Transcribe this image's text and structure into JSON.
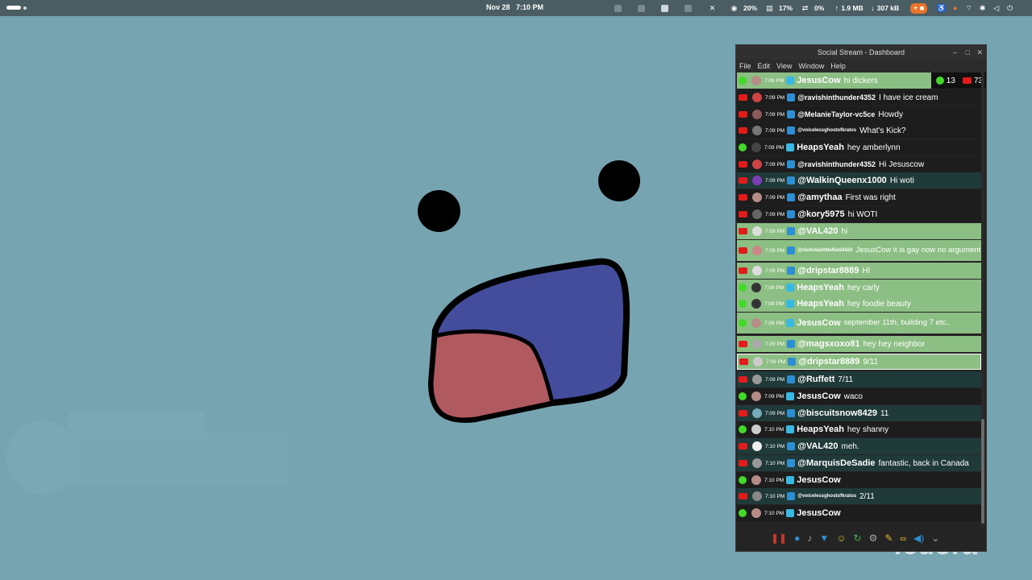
{
  "topbar": {
    "date": "Nov 28",
    "time": "7:10 PM",
    "cpu": "20%",
    "mem": "17%",
    "swap": "0%",
    "net_up": "1.9 MB",
    "net_down": "307 kB"
  },
  "window": {
    "title": "Social Stream - Dashboard",
    "menu": [
      "File",
      "Edit",
      "View",
      "Window",
      "Help"
    ],
    "counters": {
      "kick": "13",
      "youtube": "73"
    }
  },
  "messages": [
    {
      "platform": "kick",
      "time": "7:09 PM",
      "user": "JesusCow",
      "text": "hi dickers",
      "style": "green"
    },
    {
      "platform": "yt",
      "time": "7:09 PM",
      "user": "@ravishinthunder4352",
      "text": "I have ice cream",
      "style": "dark"
    },
    {
      "platform": "yt",
      "time": "7:09 PM",
      "user": "@MelanieTaylor-vc5ce",
      "text": "Howdy",
      "style": "dark"
    },
    {
      "platform": "yt",
      "time": "7:09 PM",
      "user": "@voicelessghostofkratos",
      "text": "What's Kick?",
      "style": "dark"
    },
    {
      "platform": "kick",
      "time": "7:09 PM",
      "user": "HeapsYeah",
      "text": "hey amberlynn",
      "style": "dark"
    },
    {
      "platform": "yt",
      "time": "7:09 PM",
      "user": "@ravishinthunder4352",
      "text": "Hi Jesuscow",
      "style": "dark"
    },
    {
      "platform": "yt",
      "time": "7:09 PM",
      "user": "@WalkinQueenx1000",
      "text": "Hi woti",
      "style": "teal"
    },
    {
      "platform": "yt",
      "time": "7:09 PM",
      "user": "@amythaa",
      "text": "First was right",
      "style": "dark"
    },
    {
      "platform": "yt",
      "time": "7:09 PM",
      "user": "@kory5975",
      "text": "hi WOTI",
      "style": "dark"
    },
    {
      "platform": "yt",
      "time": "7:09 PM",
      "user": "@VAL420",
      "text": "hi",
      "style": "green"
    },
    {
      "platform": "yt",
      "time": "7:09 PM",
      "user": "@nicholaslittlefield4424",
      "text": "JesusCow it is gay now no argument",
      "style": "green"
    },
    {
      "platform": "yt",
      "time": "7:09 PM",
      "user": "@dripstar8889",
      "text": "HI",
      "style": "green"
    },
    {
      "platform": "kick",
      "time": "7:09 PM",
      "user": "HeapsYeah",
      "text": "hey carly",
      "style": "green"
    },
    {
      "platform": "kick",
      "time": "7:09 PM",
      "user": "HeapsYeah",
      "text": "hey foodie beauty",
      "style": "green"
    },
    {
      "platform": "kick",
      "time": "7:09 PM",
      "user": "JesusCow",
      "text": "september 11th, building 7 etc..",
      "style": "green"
    },
    {
      "platform": "yt",
      "time": "7:09 PM",
      "user": "@magsxoxo81",
      "text": "hey hey neighbor",
      "style": "green"
    },
    {
      "platform": "yt",
      "time": "7:09 PM",
      "user": "@dripstar8889",
      "text": "9/11",
      "style": "hl"
    },
    {
      "platform": "yt",
      "time": "7:09 PM",
      "user": "@Ruffett",
      "text": "7/11",
      "style": "teal"
    },
    {
      "platform": "kick",
      "time": "7:09 PM",
      "user": "JesusCow",
      "text": "waco",
      "style": "dark"
    },
    {
      "platform": "yt",
      "time": "7:09 PM",
      "user": "@biscuitsnow8429",
      "text": "11",
      "style": "teal"
    },
    {
      "platform": "kick",
      "time": "7:10 PM",
      "user": "HeapsYeah",
      "text": "hey shanny",
      "style": "dark"
    },
    {
      "platform": "yt",
      "time": "7:10 PM",
      "user": "@VAL420",
      "text": "meh.",
      "style": "teal"
    },
    {
      "platform": "yt",
      "time": "7:10 PM",
      "user": "@MarquisDeSadie",
      "text": "fantastic, back in Canada",
      "style": "teal"
    },
    {
      "platform": "kick",
      "time": "7:10 PM",
      "user": "JesusCow",
      "text": "",
      "style": "dark"
    },
    {
      "platform": "yt",
      "time": "7:10 PM",
      "user": "@voicelessghostofkratos",
      "text": "2/11",
      "style": "teal"
    },
    {
      "platform": "kick",
      "time": "7:10 PM",
      "user": "JesusCow",
      "text": "",
      "style": "dark"
    }
  ],
  "watermark": {
    "text": "fedora"
  },
  "colors": {
    "background": "#76a5b1",
    "mouth_top": "#434d9b",
    "mouth_bottom": "#b05a5f",
    "chat_green": "#8cbf83"
  }
}
